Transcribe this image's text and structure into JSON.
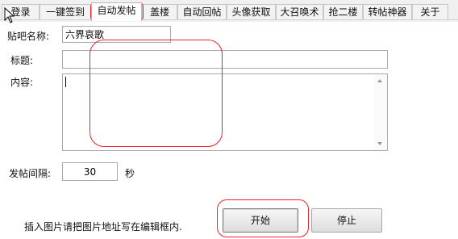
{
  "tabs": [
    {
      "label": "登录"
    },
    {
      "label": "一键签到"
    },
    {
      "label": "自动发帖",
      "active": true
    },
    {
      "label": "盖楼"
    },
    {
      "label": "自动回帖"
    },
    {
      "label": "头像获取"
    },
    {
      "label": "大召唤术"
    },
    {
      "label": "抢二楼"
    },
    {
      "label": "转帖神器"
    },
    {
      "label": "关于"
    }
  ],
  "form": {
    "forum_name_label": "贴吧名称:",
    "forum_name_value": "六界哀歌",
    "title_label": "标题:",
    "title_value": "",
    "content_label": "内容:",
    "content_value": "",
    "interval_label": "发帖间隔:",
    "interval_value": "30",
    "interval_unit": "秒",
    "hint": "插入图片请把图片地址写在编辑框内."
  },
  "buttons": {
    "start_label": "开始",
    "stop_label": "停止"
  },
  "colors": {
    "annotation": "#e8232a"
  }
}
